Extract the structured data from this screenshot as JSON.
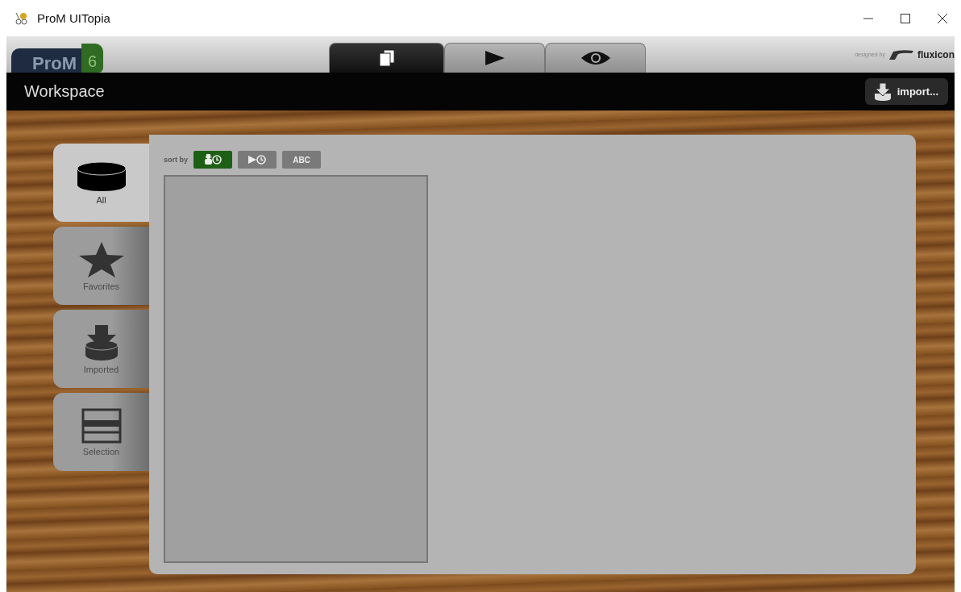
{
  "window": {
    "title": "ProM UITopia"
  },
  "header": {
    "logo": {
      "name": "ProM",
      "version": "6"
    },
    "tabs": [
      {
        "kind": "workspace",
        "selected": true
      },
      {
        "kind": "action",
        "selected": false
      },
      {
        "kind": "view",
        "selected": false
      }
    ],
    "credit": {
      "label": "designed by",
      "brand": "fluxicon"
    }
  },
  "toolbar": {
    "title": "Workspace",
    "import_button": "import..."
  },
  "categories": [
    {
      "kind": "all",
      "label": "All",
      "selected": true
    },
    {
      "kind": "favorites",
      "label": "Favorites",
      "selected": false
    },
    {
      "kind": "imported",
      "label": "Imported",
      "selected": false
    },
    {
      "kind": "selection",
      "label": "Selection",
      "selected": false
    }
  ],
  "sort": {
    "label": "sort by",
    "options": [
      {
        "kind": "import-time",
        "selected": true
      },
      {
        "kind": "run-time",
        "selected": false
      },
      {
        "kind": "alphabetical",
        "label": "ABC",
        "selected": false
      }
    ]
  }
}
